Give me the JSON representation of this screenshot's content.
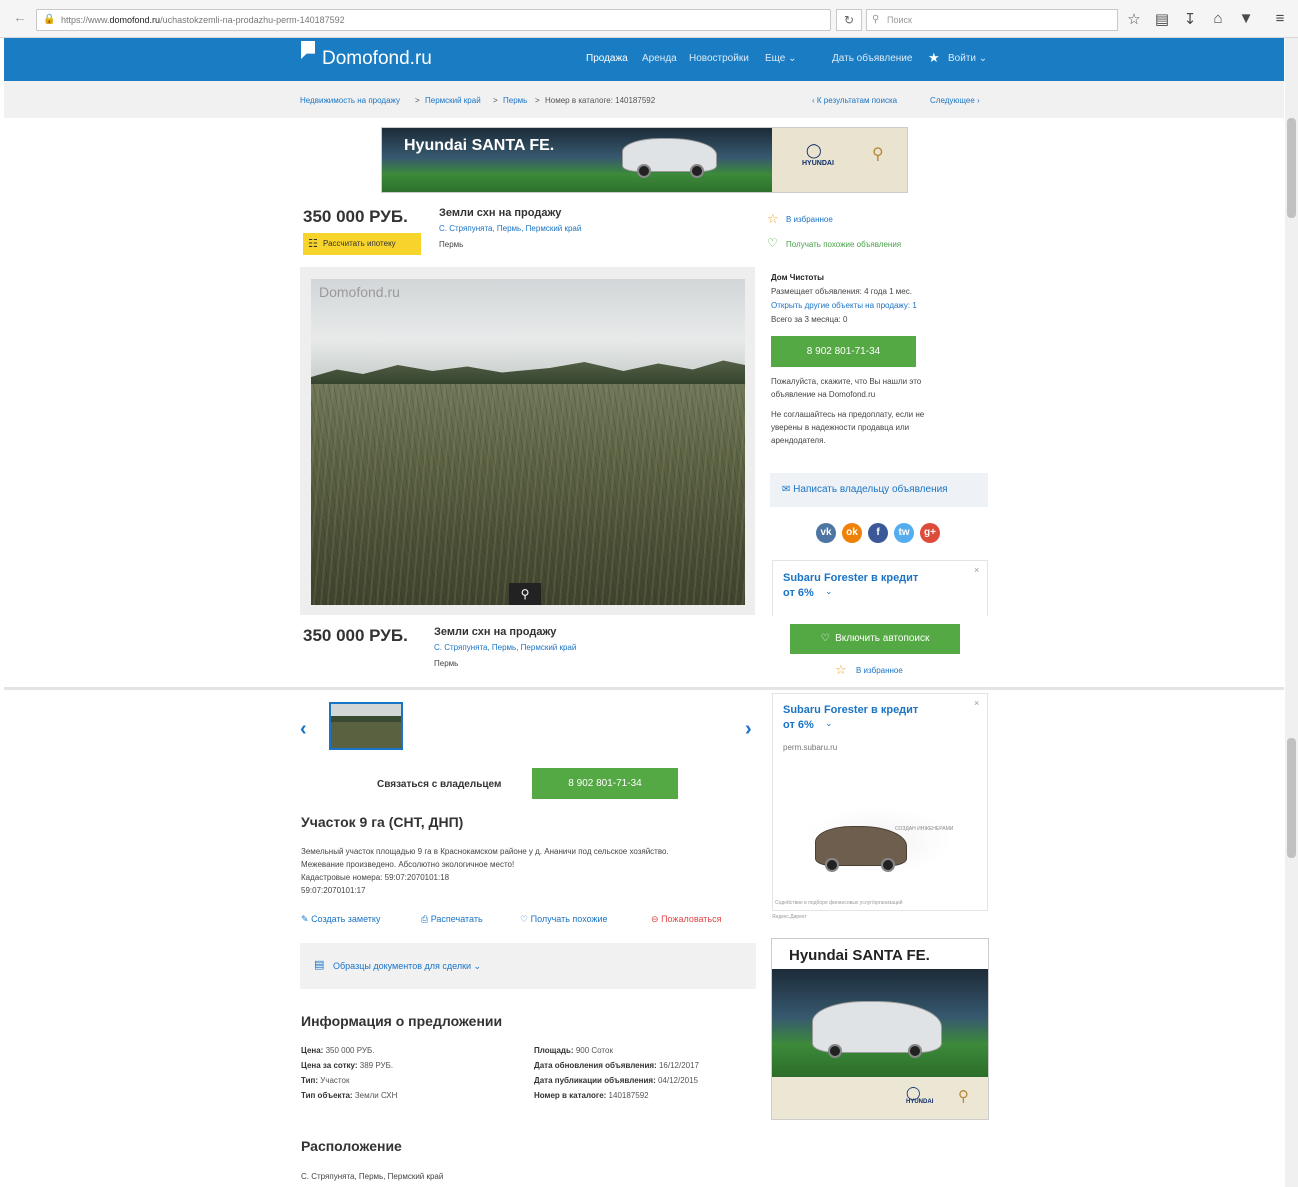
{
  "browser": {
    "url_prefix": "https://www.",
    "url_domain": "domofond.ru",
    "url_path": "/uchastokzemli-na-prodazhu-perm-140187592",
    "search_placeholder": "Поиск"
  },
  "header": {
    "logo": "Domofond.ru",
    "nav": [
      "Продажа",
      "Аренда",
      "Новостройки",
      "Еще ⌄"
    ],
    "post_ad": "Дать объявление",
    "login": "Войти ⌄"
  },
  "breadcrumb": {
    "items": [
      "Недвижимость на продажу",
      "Пермский край",
      "Пермь"
    ],
    "catalog": "Номер в каталоге: 140187592",
    "back": "‹ К результатам поиска",
    "next": "Следующее ›"
  },
  "banner_top": {
    "text": "Hyundai SANTA FE.",
    "brand": "HYUNDAI"
  },
  "listing": {
    "price": "350 000 РУБ.",
    "title": "Земли схн на продажу",
    "address": "С. Стряпунята, Пермь, Пермский край",
    "city": "Пермь",
    "mortgage_button": "Рассчитать ипотеку",
    "watermark": "Domofond.ru"
  },
  "sidebar": {
    "favorite": "В избранное",
    "similar": "Получать похожие объявления",
    "seller_name": "Дом Чистоты",
    "seller_since": "Размещает объявления: 4 года 1 мес.",
    "seller_other": "Открыть другие объекты на продажу: 1",
    "seller_total": "Всего за 3 месяца: 0",
    "phone": "8 902 801-71-34",
    "note1_line1": "Пожалуйста, скажите, что Вы нашли это",
    "note1_line2": "объявление на Domofond.ru",
    "note2_line1": "Не соглашайтесь на предоплату, если не",
    "note2_line2": "уверены в надежности продавца или",
    "note2_line3": "арендодателя.",
    "write_owner": "Написать владельцу объявления",
    "social": [
      "vk",
      "ok",
      "f",
      "tw",
      "g+"
    ],
    "ad_title_1": "Subaru Forester в кредит",
    "ad_title_2": "от 6%",
    "ad_domain": "perm.subaru.ru",
    "ad_caption": "СОЗДАН ИНЖЕНЕРАМИ",
    "ad_footer": "Содействие в подборе финансовых услуг/организаций",
    "ad_source": "Яндекс.Директ",
    "autosearch": "Включить автопоиск",
    "close": "×"
  },
  "sticky": {
    "price": "350 000 РУБ.",
    "title": "Земли схн на продажу",
    "address": "С. Стряпунята, Пермь, Пермский край",
    "city": "Пермь"
  },
  "gallery": {
    "prev": "‹",
    "next": "›"
  },
  "contact": {
    "label": "Связаться с владельцем",
    "phone": "8 902 801-71-34"
  },
  "description": {
    "heading": "Участок 9 га (СНТ, ДНП)",
    "lines": [
      "Земельный участок площадью 9 га в Краснокамском районе у д. Ананичи под сельское хозяйство.",
      "Межевание произведено. Абсолютно экологичное место!",
      "Кадастровые номера: 59:07:2070101:18",
      "59:07:2070101:17"
    ]
  },
  "actions": {
    "note": "Создать заметку",
    "print": "Распечатать",
    "similar": "Получать похожие",
    "report": "Пожаловаться"
  },
  "documents": "Образцы документов для сделки ⌄",
  "info": {
    "heading": "Информация о предложении",
    "left": [
      {
        "k": "Цена:",
        "v": "350 000 РУБ."
      },
      {
        "k": "Цена за сотку:",
        "v": "389 РУБ."
      },
      {
        "k": "Тип:",
        "v": "Участок"
      },
      {
        "k": "Тип объекта:",
        "v": "Земли СХН"
      }
    ],
    "right": [
      {
        "k": "Площадь:",
        "v": "900 Соток"
      },
      {
        "k": "Дата обновления объявления:",
        "v": "16/12/2017"
      },
      {
        "k": "Дата публикации объявления:",
        "v": "04/12/2015"
      },
      {
        "k": "Номер в каталоге:",
        "v": "140187592"
      }
    ]
  },
  "location": {
    "heading": "Расположение",
    "address": "С. Стряпунята, Пермь, Пермский край"
  },
  "banner_side": {
    "text": "Hyundai SANTA FE.",
    "brand": "HYUNDAI"
  },
  "colors": {
    "header": "#1a7dc3",
    "green": "#55a944",
    "link": "#1a74c5",
    "mortgage": "#f6d42b"
  }
}
